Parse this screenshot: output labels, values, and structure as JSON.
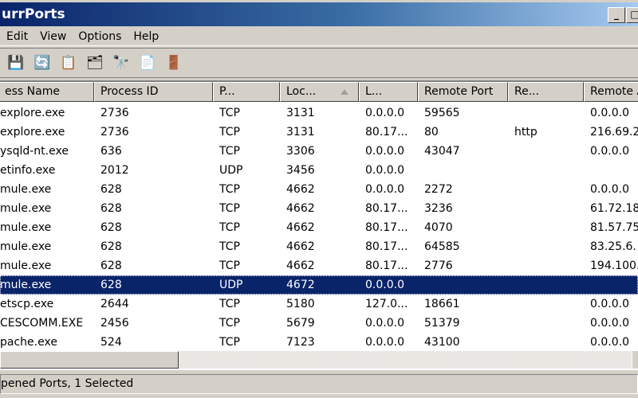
{
  "window": {
    "title": "urrPorts",
    "minimize": "_",
    "maximize": "□"
  },
  "menu": [
    "Edit",
    "View",
    "Options",
    "Help"
  ],
  "toolbar": [
    {
      "name": "save-icon",
      "glyph": "💾"
    },
    {
      "name": "refresh-icon",
      "glyph": "🔄"
    },
    {
      "name": "copy-icon",
      "glyph": "📋"
    },
    {
      "name": "properties-icon",
      "glyph": "🗂"
    },
    {
      "name": "find-icon",
      "glyph": "🔭"
    },
    {
      "name": "html-report-icon",
      "glyph": "📄"
    },
    {
      "name": "exit-icon",
      "glyph": "🚪"
    }
  ],
  "columns": [
    "ess Name",
    "Process ID",
    "P...",
    "Loc...",
    "L...",
    "Remote Port",
    "Re...",
    "Remote A"
  ],
  "rows": [
    [
      "explore.exe",
      "2736",
      "TCP",
      "3131",
      "0.0.0.0",
      "59565",
      "",
      "0.0.0.0"
    ],
    [
      "explore.exe",
      "2736",
      "TCP",
      "3131",
      "80.17...",
      "80",
      "http",
      "216.69.2"
    ],
    [
      "ysqld-nt.exe",
      "636",
      "TCP",
      "3306",
      "0.0.0.0",
      "43047",
      "",
      "0.0.0.0"
    ],
    [
      "etinfo.exe",
      "2012",
      "UDP",
      "3456",
      "0.0.0.0",
      "",
      "",
      ""
    ],
    [
      "mule.exe",
      "628",
      "TCP",
      "4662",
      "0.0.0.0",
      "2272",
      "",
      "0.0.0.0"
    ],
    [
      "mule.exe",
      "628",
      "TCP",
      "4662",
      "80.17...",
      "3236",
      "",
      "61.72.18"
    ],
    [
      "mule.exe",
      "628",
      "TCP",
      "4662",
      "80.17...",
      "4070",
      "",
      "81.57.75"
    ],
    [
      "mule.exe",
      "628",
      "TCP",
      "4662",
      "80.17...",
      "64585",
      "",
      "83.25.6."
    ],
    [
      "mule.exe",
      "628",
      "TCP",
      "4662",
      "80.17...",
      "2776",
      "",
      "194.100."
    ],
    [
      "mule.exe",
      "628",
      "UDP",
      "4672",
      "0.0.0.0",
      "",
      "",
      ""
    ],
    [
      "etscp.exe",
      "2644",
      "TCP",
      "5180",
      "127.0...",
      "18661",
      "",
      "0.0.0.0"
    ],
    [
      "CESCOMM.EXE",
      "2456",
      "TCP",
      "5679",
      "0.0.0.0",
      "51379",
      "",
      "0.0.0.0"
    ],
    [
      "pache.exe",
      "524",
      "TCP",
      "7123",
      "0.0.0.0",
      "43100",
      "",
      "0.0.0.0"
    ]
  ],
  "selected_row": 9,
  "status": "pened Ports, 1 Selected",
  "colors": {
    "selection": "#0a246a",
    "titlebar": "#0a246a"
  }
}
